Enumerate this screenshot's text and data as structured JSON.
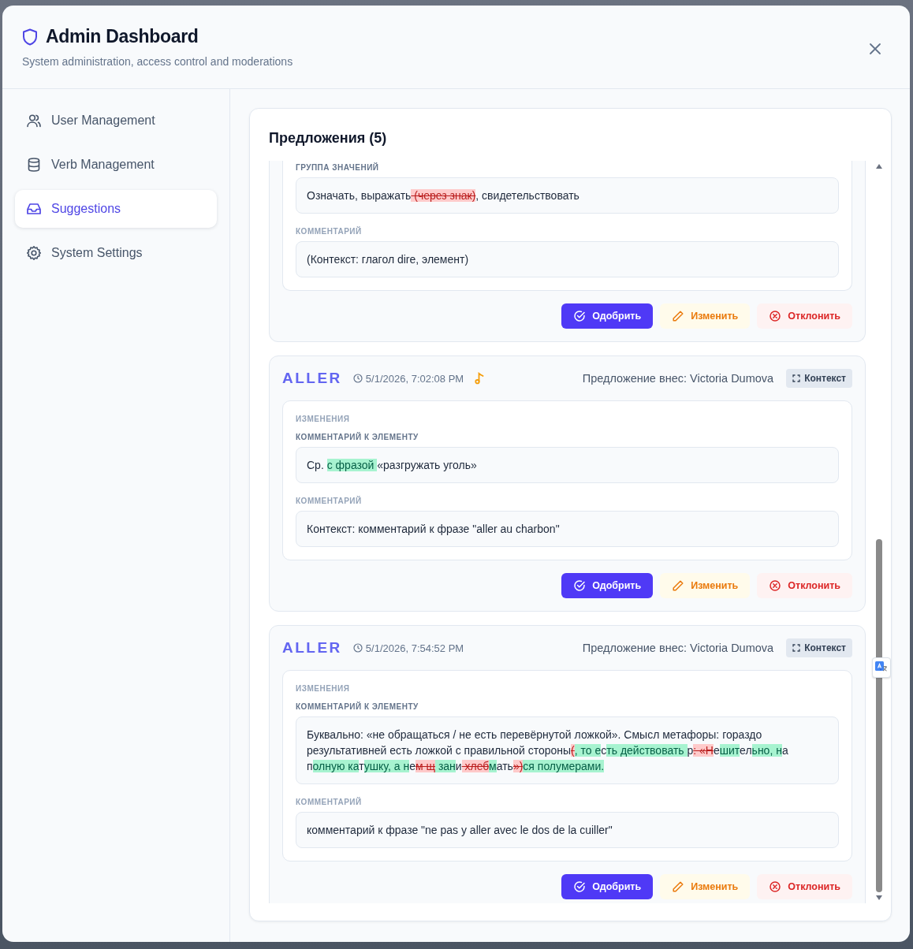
{
  "header": {
    "title": "Admin Dashboard",
    "subtitle": "System administration, access control and moderations"
  },
  "sidebar": {
    "items": [
      {
        "label": "User Management",
        "kind": "users",
        "selected": false
      },
      {
        "label": "Verb Management",
        "kind": "database",
        "selected": false
      },
      {
        "label": "Suggestions",
        "kind": "inbox",
        "selected": true
      },
      {
        "label": "System Settings",
        "kind": "gear",
        "selected": false
      }
    ]
  },
  "panel": {
    "title": "Предложения (5)",
    "suggestions": [
      {
        "field_label": "ГРУППА ЗНАЧЕНИЙ",
        "diff": [
          {
            "kind": "same",
            "text": "Означать, выражать"
          },
          {
            "kind": "del",
            "text": " (через знак)"
          },
          {
            "kind": "same",
            "text": ", свидетельствовать"
          }
        ],
        "comment_label": "КОММЕНТАРИЙ",
        "comment": "(Контекст: глагол dire, элемент)",
        "actions": [
          {
            "kind": "approve",
            "label": "Одобрить"
          },
          {
            "kind": "edit",
            "label": "Изменить"
          },
          {
            "kind": "reject",
            "label": "Отклонить"
          }
        ]
      },
      {
        "verb": "ALLER",
        "time": "5/1/2026, 7:02:08 PM",
        "audio": true,
        "author": "Предложение внес: Victoria Dumova",
        "context_button": "Контекст",
        "section_title": "ИЗМЕНЕНИЯ",
        "field_label": "КОММЕНТАРИЙ К ЭЛЕМЕНТУ",
        "diff": [
          {
            "kind": "same",
            "text": "Ср. "
          },
          {
            "kind": "ins",
            "text": "с фразой "
          },
          {
            "kind": "same",
            "text": "«разгружать уголь»"
          }
        ],
        "comment_label": "КОММЕНТАРИЙ",
        "comment": "Контекст: комментарий к фразе \"aller au charbon\"",
        "actions": [
          {
            "kind": "approve",
            "label": "Одобрить"
          },
          {
            "kind": "edit",
            "label": "Изменить"
          },
          {
            "kind": "reject",
            "label": "Отклонить"
          }
        ]
      },
      {
        "verb": "ALLER",
        "time": "5/1/2026, 7:54:52 PM",
        "audio": false,
        "author": "Предложение внес: Victoria Dumova",
        "context_button": "Контекст",
        "section_title": "ИЗМЕНЕНИЯ",
        "field_label": "КОММЕНТАРИЙ К ЭЛЕМЕНТУ",
        "diff": [
          {
            "kind": "same",
            "text": "Буквально: «не обращаться / не есть перевёрнутой ложкой». Смысл метафоры: гораздо результативней есть ложкой с правильной стороны"
          },
          {
            "kind": "del",
            "text": "("
          },
          {
            "kind": "ins",
            "text": ", то е"
          },
          {
            "kind": "same",
            "text": "с"
          },
          {
            "kind": "ins",
            "text": "ть действовать "
          },
          {
            "kind": "same",
            "text": "р"
          },
          {
            "kind": "del",
            "text": ": «Н"
          },
          {
            "kind": "same",
            "text": "е"
          },
          {
            "kind": "ins",
            "text": "шит"
          },
          {
            "kind": "same",
            "text": "ел"
          },
          {
            "kind": "ins",
            "text": "ьно, н"
          },
          {
            "kind": "same",
            "text": "а п"
          },
          {
            "kind": "ins",
            "text": "олную ка"
          },
          {
            "kind": "same",
            "text": "т"
          },
          {
            "kind": "ins",
            "text": "ушку, а н"
          },
          {
            "kind": "same",
            "text": "е"
          },
          {
            "kind": "del",
            "text": "м щ"
          },
          {
            "kind": "ins",
            "text": " зан"
          },
          {
            "kind": "same",
            "text": "и"
          },
          {
            "kind": "del",
            "text": " хлеб"
          },
          {
            "kind": "ins",
            "text": "м"
          },
          {
            "kind": "same",
            "text": "ать"
          },
          {
            "kind": "del",
            "text": "»)"
          },
          {
            "kind": "ins",
            "text": "ся полумерами."
          }
        ],
        "comment_label": "КОММЕНТАРИЙ",
        "comment": "комментарий к фразе \"ne pas y aller avec le dos de la cuiller\"",
        "actions": [
          {
            "kind": "approve",
            "label": "Одобрить"
          },
          {
            "kind": "edit",
            "label": "Изменить"
          },
          {
            "kind": "reject",
            "label": "Отклонить"
          }
        ]
      }
    ]
  }
}
